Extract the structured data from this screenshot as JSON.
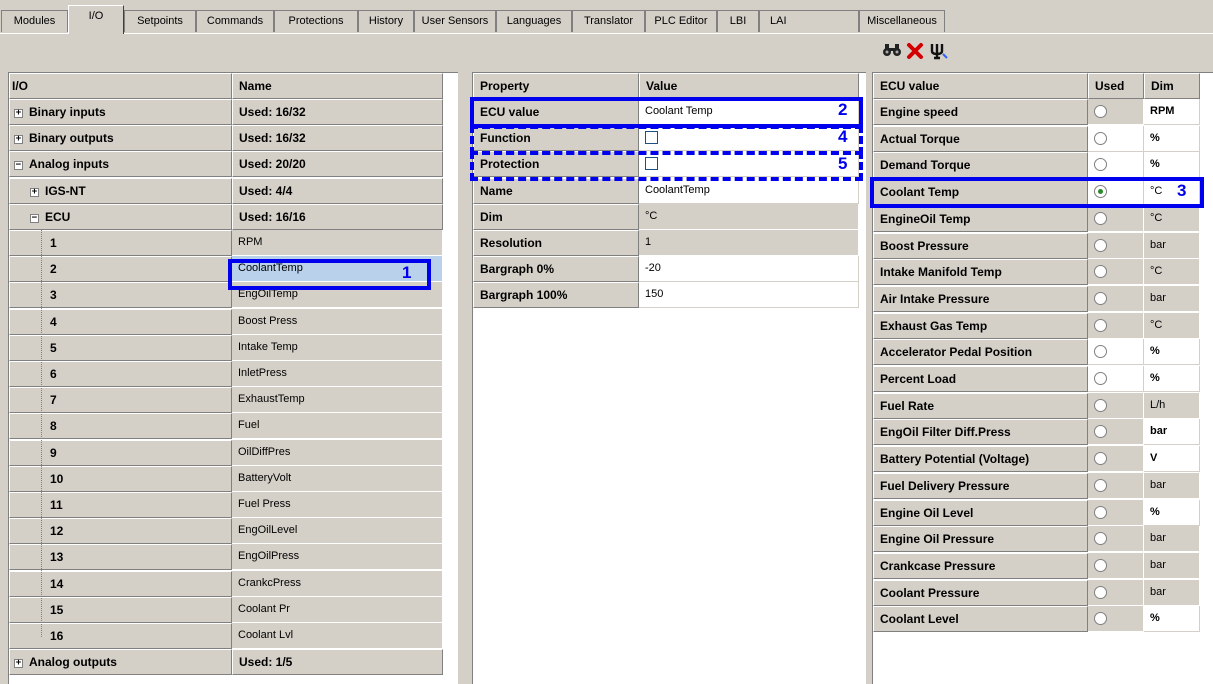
{
  "tabs": [
    "Modules",
    "I/O",
    "Setpoints",
    "Commands",
    "Protections",
    "History",
    "User Sensors",
    "Languages",
    "Translator",
    "PLC Editor",
    "LBI",
    "LAI",
    "Miscellaneous"
  ],
  "active_tab": "I/O",
  "toolbar": {
    "find_icon": "binoculars-icon",
    "delete_icon": "red-x-icon",
    "tool_icon": "psi-icon"
  },
  "io_panel": {
    "headers": {
      "io": "I/O",
      "name": "Name"
    },
    "groups": [
      {
        "label": "Binary inputs",
        "used": "Used: 16/32",
        "expander": "+"
      },
      {
        "label": "Binary outputs",
        "used": "Used: 16/32",
        "expander": "+"
      },
      {
        "label": "Analog inputs",
        "used": "Used: 20/20",
        "expander": "−"
      },
      {
        "label": "IGS-NT",
        "used": "Used: 4/4",
        "expander": "+"
      },
      {
        "label": "ECU",
        "used": "Used: 16/16",
        "expander": "−"
      }
    ],
    "ecu_rows": [
      {
        "num": "1",
        "name": "RPM"
      },
      {
        "num": "2",
        "name": "CoolantTemp"
      },
      {
        "num": "3",
        "name": "EngOilTemp"
      },
      {
        "num": "4",
        "name": "Boost Press"
      },
      {
        "num": "5",
        "name": "Intake Temp"
      },
      {
        "num": "6",
        "name": "InletPress"
      },
      {
        "num": "7",
        "name": "ExhaustTemp"
      },
      {
        "num": "8",
        "name": "Fuel"
      },
      {
        "num": "9",
        "name": "OilDiffPres"
      },
      {
        "num": "10",
        "name": "BatteryVolt"
      },
      {
        "num": "11",
        "name": "Fuel Press"
      },
      {
        "num": "12",
        "name": "EngOilLevel"
      },
      {
        "num": "13",
        "name": "EngOilPress"
      },
      {
        "num": "14",
        "name": "CrankcPress"
      },
      {
        "num": "15",
        "name": "Coolant Pr"
      },
      {
        "num": "16",
        "name": "Coolant Lvl"
      }
    ],
    "footer": {
      "label": "Analog outputs",
      "used": "Used: 1/5",
      "expander": "+"
    }
  },
  "property_panel": {
    "headers": {
      "property": "Property",
      "value": "Value"
    },
    "rows": [
      {
        "property": "ECU value",
        "value": "Coolant Temp"
      },
      {
        "property": "Function",
        "value": ""
      },
      {
        "property": "Protection",
        "value": ""
      },
      {
        "property": "Name",
        "value": "CoolantTemp"
      },
      {
        "property": "Dim",
        "value": "°C"
      },
      {
        "property": "Resolution",
        "value": "1"
      },
      {
        "property": "Bargraph 0%",
        "value": "-20"
      },
      {
        "property": "Bargraph 100%",
        "value": "150"
      }
    ]
  },
  "ecu_panel": {
    "headers": {
      "value": "ECU value",
      "used": "Used",
      "dim": "Dim"
    },
    "rows": [
      {
        "value": "Engine speed",
        "selected": false,
        "dim": "RPM"
      },
      {
        "value": "Actual Torque",
        "selected": false,
        "dim": "%"
      },
      {
        "value": "Demand Torque",
        "selected": false,
        "dim": "%"
      },
      {
        "value": "Coolant Temp",
        "selected": true,
        "dim": "°C"
      },
      {
        "value": "EngineOil Temp",
        "selected": false,
        "dim": "°C"
      },
      {
        "value": "Boost Pressure",
        "selected": false,
        "dim": "bar"
      },
      {
        "value": "Intake Manifold Temp",
        "selected": false,
        "dim": "°C"
      },
      {
        "value": "Air Intake Pressure",
        "selected": false,
        "dim": "bar"
      },
      {
        "value": "Exhaust Gas Temp",
        "selected": false,
        "dim": "°C"
      },
      {
        "value": "Accelerator Pedal Position",
        "selected": false,
        "dim": "%"
      },
      {
        "value": "Percent Load",
        "selected": false,
        "dim": "%"
      },
      {
        "value": "Fuel Rate",
        "selected": false,
        "dim": "L/h"
      },
      {
        "value": "EngOil Filter Diff.Press",
        "selected": false,
        "dim": "bar"
      },
      {
        "value": "Battery Potential (Voltage)",
        "selected": false,
        "dim": "V"
      },
      {
        "value": "Fuel Delivery Pressure",
        "selected": false,
        "dim": "bar"
      },
      {
        "value": "Engine Oil Level",
        "selected": false,
        "dim": "%"
      },
      {
        "value": "Engine Oil Pressure",
        "selected": false,
        "dim": "bar"
      },
      {
        "value": "Crankcase Pressure",
        "selected": false,
        "dim": "bar"
      },
      {
        "value": "Coolant Pressure",
        "selected": false,
        "dim": "bar"
      },
      {
        "value": "Coolant Level",
        "selected": false,
        "dim": "%"
      }
    ]
  },
  "callouts": [
    "1",
    "2",
    "3",
    "4",
    "5"
  ],
  "colors": {
    "callout": "#0000ee",
    "panel_grey": "#d4d0c8",
    "selection": "#b9d1ea"
  }
}
